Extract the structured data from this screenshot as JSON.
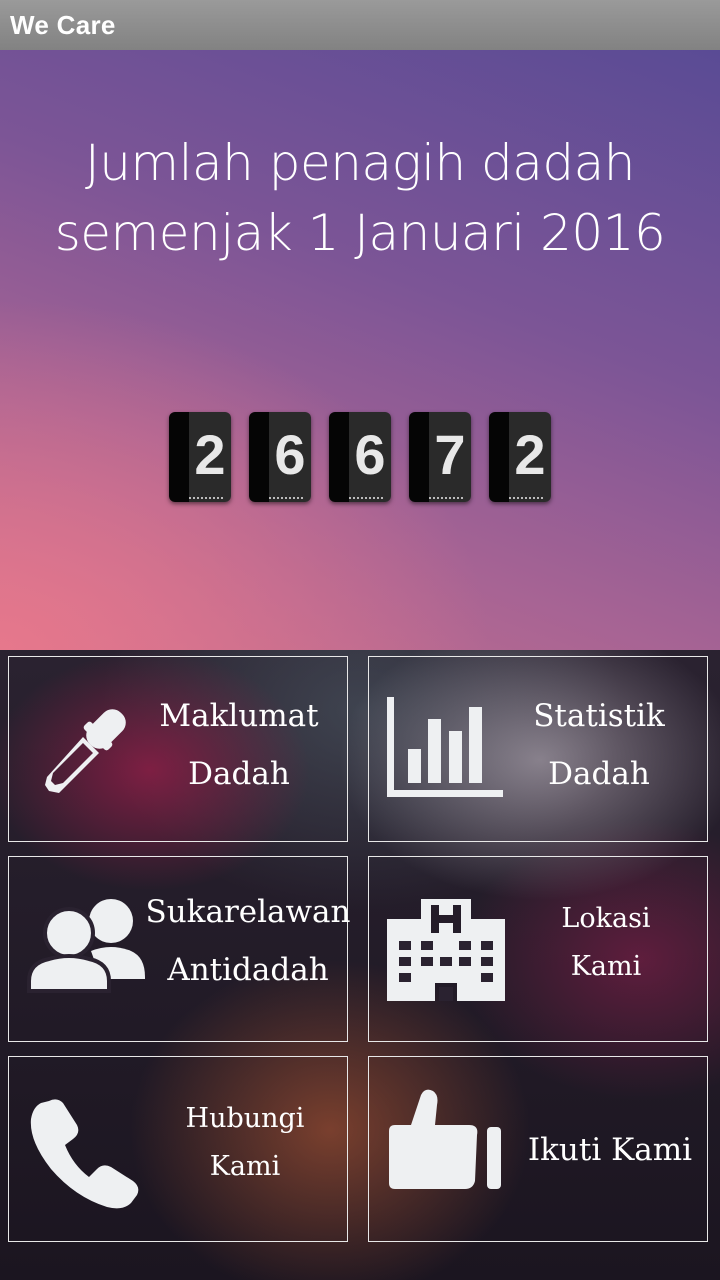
{
  "app": {
    "title": "We Care"
  },
  "hero": {
    "headline_line1": "Jumlah penagih dadah",
    "headline_line2": "semenjak 1 Januari 2016",
    "counter_digits": [
      "2",
      "6",
      "6",
      "7",
      "2"
    ]
  },
  "menu": {
    "tiles": [
      {
        "line1": "Maklumat",
        "line2": "Dadah",
        "icon": "dropper-icon"
      },
      {
        "line1": "Statistik",
        "line2": "Dadah",
        "icon": "bar-chart-icon"
      },
      {
        "line1": "Sukarelawan",
        "line2": "Antidadah",
        "icon": "people-icon"
      },
      {
        "line1": "Lokasi",
        "line2": "Kami",
        "icon": "hospital-icon"
      },
      {
        "line1": "Hubungi",
        "line2": "Kami",
        "icon": "phone-icon"
      },
      {
        "line1": "Ikuti Kami",
        "icon": "thumbs-up-icon"
      }
    ]
  },
  "colors": {
    "icon": "#eef0f2",
    "border": "#e8e8e8",
    "text": "#ffffff"
  }
}
